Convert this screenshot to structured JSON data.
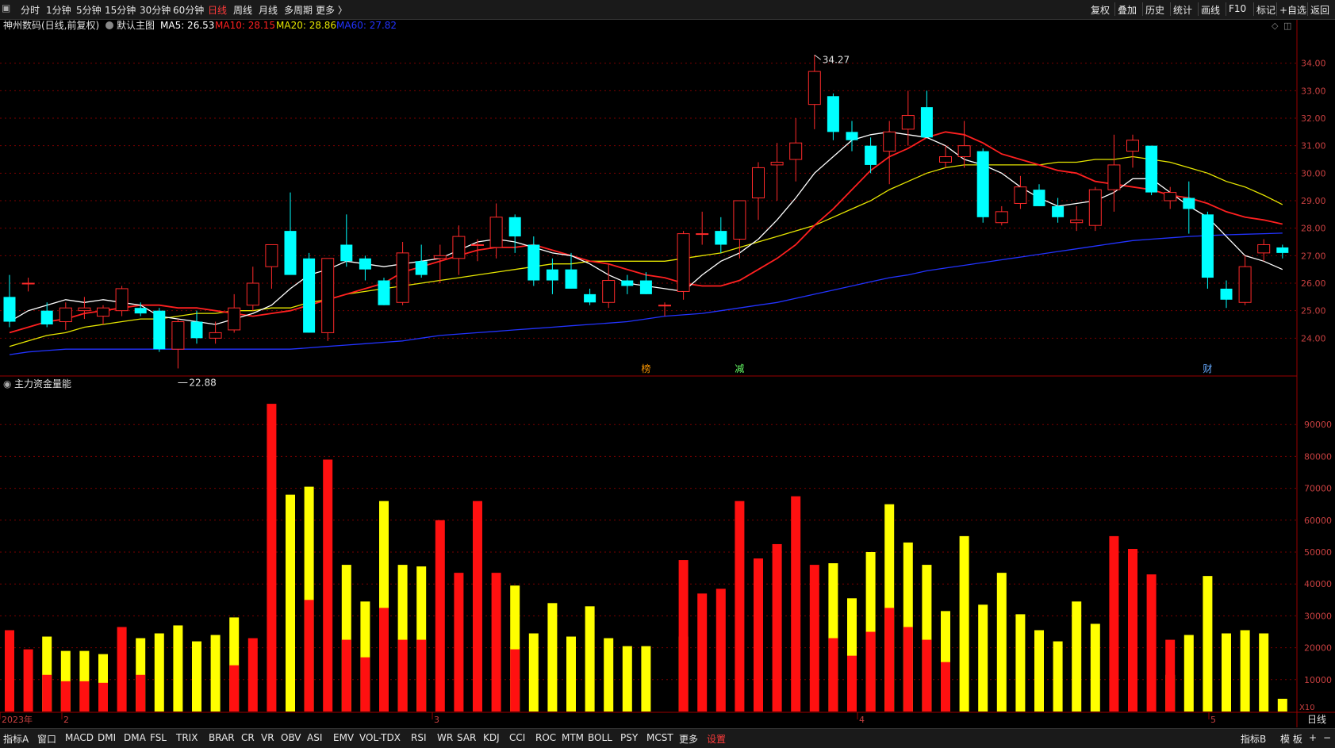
{
  "toolbar": {
    "left": [
      {
        "id": "minute",
        "label": "分时"
      },
      {
        "id": "1m",
        "label": "1分钟"
      },
      {
        "id": "5m",
        "label": "5分钟"
      },
      {
        "id": "15m",
        "label": "15分钟"
      },
      {
        "id": "30m",
        "label": "30分钟"
      },
      {
        "id": "60m",
        "label": "60分钟"
      },
      {
        "id": "day",
        "label": "日线",
        "active": true
      },
      {
        "id": "week",
        "label": "周线"
      },
      {
        "id": "month",
        "label": "月线"
      },
      {
        "id": "multi",
        "label": "多周期"
      },
      {
        "id": "more",
        "label": "更多 〉"
      }
    ],
    "right": [
      {
        "id": "fuquan",
        "label": "复权"
      },
      {
        "id": "diejia",
        "label": "叠加"
      },
      {
        "id": "lishi",
        "label": "历史"
      },
      {
        "id": "tongji",
        "label": "统计"
      },
      {
        "id": "huaxian",
        "label": "画线"
      },
      {
        "id": "f10",
        "label": "F10"
      },
      {
        "id": "biaoji",
        "label": "标记"
      },
      {
        "id": "zixuan",
        "label": "+自选"
      },
      {
        "id": "fanhui",
        "label": "返回"
      }
    ]
  },
  "legend": {
    "stock": "神州数码(日线,前复权)",
    "main_template": "默认主图",
    "ma5": "MA5: 26.53",
    "ma10": "MA10: 28.15",
    "ma20": "MA20: 28.86",
    "ma60": "MA60: 27.82",
    "indicator_title": "主力资金量能"
  },
  "colors": {
    "up": "#ff2a2a",
    "down": "#00ffff",
    "ma5": "#ffffff",
    "ma10": "#ff2020",
    "ma20": "#e6e600",
    "ma60": "#2233ff",
    "vol_red": "#ff1010",
    "vol_yellow": "#ffff00",
    "grid": "#7a0000",
    "axis_text": "#c84040"
  },
  "chart_data": [
    {
      "type": "candlestick",
      "title": "神州数码(日线,前复权)",
      "ylim": [
        23.0,
        35.0
      ],
      "y_ticks": [
        24.0,
        25.0,
        26.0,
        27.0,
        28.0,
        29.0,
        30.0,
        31.0,
        32.0,
        33.0,
        34.0
      ],
      "max_label": "34.27",
      "min_label": "22.88",
      "markers": [
        "榜",
        "减",
        "财"
      ],
      "x_labels": [
        "2023年",
        "2",
        "3",
        "4",
        "5"
      ],
      "ohlc": [
        [
          25.5,
          26.3,
          24.4,
          24.6
        ],
        [
          26.0,
          26.2,
          25.7,
          26.0
        ],
        [
          25.0,
          25.3,
          24.4,
          24.5
        ],
        [
          24.6,
          25.3,
          24.3,
          25.1
        ],
        [
          25.0,
          25.5,
          24.7,
          25.1
        ],
        [
          24.8,
          25.2,
          24.5,
          25.1
        ],
        [
          25.0,
          25.9,
          24.8,
          25.8
        ],
        [
          25.1,
          25.3,
          24.8,
          24.9
        ],
        [
          25.0,
          25.1,
          23.5,
          23.6
        ],
        [
          23.6,
          24.7,
          22.9,
          24.6
        ],
        [
          24.6,
          25.0,
          23.8,
          24.0
        ],
        [
          24.0,
          24.6,
          23.8,
          24.2
        ],
        [
          24.3,
          25.6,
          24.2,
          25.1
        ],
        [
          25.2,
          26.6,
          25.0,
          26.0
        ],
        [
          26.6,
          27.3,
          25.8,
          27.4
        ],
        [
          27.9,
          29.3,
          26.7,
          26.3
        ],
        [
          26.9,
          27.1,
          24.2,
          24.2
        ],
        [
          24.2,
          26.9,
          23.9,
          26.9
        ],
        [
          27.4,
          28.5,
          26.6,
          26.8
        ],
        [
          26.9,
          27.0,
          26.1,
          26.5
        ],
        [
          26.1,
          26.2,
          25.2,
          25.2
        ],
        [
          25.3,
          27.5,
          25.2,
          27.1
        ],
        [
          26.8,
          27.4,
          26.2,
          26.3
        ],
        [
          26.9,
          27.4,
          26.0,
          27.0
        ],
        [
          26.9,
          28.1,
          26.3,
          27.7
        ],
        [
          27.4,
          27.6,
          26.8,
          27.4
        ],
        [
          27.3,
          28.9,
          26.9,
          28.4
        ],
        [
          28.4,
          28.5,
          27.1,
          27.7
        ],
        [
          27.4,
          27.7,
          25.9,
          26.1
        ],
        [
          26.5,
          26.9,
          25.6,
          26.1
        ],
        [
          26.5,
          27.1,
          25.8,
          25.8
        ],
        [
          25.6,
          25.8,
          25.2,
          25.3
        ],
        [
          25.3,
          26.7,
          25.1,
          26.1
        ],
        [
          26.1,
          26.3,
          25.6,
          25.9
        ],
        [
          26.1,
          26.4,
          25.6,
          25.6
        ],
        [
          25.2,
          25.3,
          24.8,
          25.2
        ],
        [
          25.7,
          27.9,
          25.4,
          27.8
        ],
        [
          27.8,
          28.6,
          27.4,
          27.8
        ],
        [
          27.9,
          28.4,
          27.1,
          27.4
        ],
        [
          27.6,
          29.0,
          26.9,
          29.0
        ],
        [
          29.1,
          30.4,
          28.3,
          30.2
        ],
        [
          30.3,
          31.1,
          29.0,
          30.4
        ],
        [
          30.5,
          32.0,
          29.7,
          31.1
        ],
        [
          32.5,
          34.3,
          31.6,
          33.7
        ],
        [
          32.8,
          32.9,
          31.2,
          31.5
        ],
        [
          31.5,
          31.9,
          30.8,
          31.2
        ],
        [
          31.0,
          31.3,
          30.0,
          30.3
        ],
        [
          30.8,
          31.9,
          29.6,
          31.5
        ],
        [
          31.6,
          33.0,
          31.0,
          32.1
        ],
        [
          32.4,
          33.0,
          31.3,
          31.3
        ],
        [
          30.4,
          31.0,
          30.2,
          30.6
        ],
        [
          30.6,
          31.9,
          30.2,
          31.0
        ],
        [
          30.8,
          30.9,
          28.2,
          28.4
        ],
        [
          28.2,
          28.8,
          28.1,
          28.6
        ],
        [
          28.9,
          29.9,
          28.7,
          29.5
        ],
        [
          29.4,
          29.6,
          28.8,
          28.8
        ],
        [
          28.8,
          29.1,
          28.2,
          28.4
        ],
        [
          28.2,
          28.8,
          27.9,
          28.3
        ],
        [
          28.1,
          29.5,
          27.9,
          29.4
        ],
        [
          29.4,
          31.4,
          28.6,
          30.3
        ],
        [
          30.8,
          31.4,
          30.2,
          31.2
        ],
        [
          31.0,
          31.0,
          29.2,
          29.3
        ],
        [
          29.0,
          29.5,
          28.7,
          29.3
        ],
        [
          29.1,
          29.7,
          27.8,
          28.7
        ],
        [
          28.5,
          28.6,
          25.8,
          26.2
        ],
        [
          25.8,
          26.1,
          25.1,
          25.4
        ],
        [
          25.3,
          27.0,
          25.2,
          26.6
        ],
        [
          27.1,
          27.6,
          26.8,
          27.4
        ],
        [
          27.3,
          27.4,
          26.9,
          27.1
        ]
      ],
      "ma5": [
        24.6,
        25.0,
        25.2,
        25.4,
        25.3,
        25.4,
        25.3,
        25.2,
        24.8,
        24.7,
        24.6,
        24.5,
        24.7,
        24.9,
        25.2,
        25.8,
        26.3,
        26.5,
        26.8,
        26.7,
        26.6,
        26.7,
        26.8,
        26.9,
        27.2,
        27.5,
        27.6,
        27.5,
        27.3,
        27.1,
        27.0,
        26.7,
        26.3,
        26.0,
        25.9,
        25.8,
        25.7,
        26.3,
        26.8,
        27.1,
        27.6,
        28.3,
        29.1,
        30.0,
        30.6,
        31.2,
        31.4,
        31.5,
        31.4,
        31.3,
        31.0,
        30.5,
        30.3,
        30.0,
        29.5,
        29.1,
        28.8,
        28.9,
        29.0,
        29.3,
        29.8,
        29.8,
        29.3,
        28.8,
        28.4,
        27.7,
        27.0,
        26.8,
        26.5
      ],
      "ma10": [
        24.2,
        24.4,
        24.6,
        24.7,
        24.9,
        25.0,
        25.1,
        25.2,
        25.2,
        25.1,
        25.1,
        25.0,
        24.9,
        24.8,
        24.9,
        25.0,
        25.2,
        25.4,
        25.6,
        25.8,
        26.0,
        26.4,
        26.6,
        26.8,
        27.0,
        27.2,
        27.3,
        27.3,
        27.4,
        27.2,
        27.0,
        26.8,
        26.7,
        26.5,
        26.3,
        26.2,
        26.0,
        25.9,
        25.9,
        26.1,
        26.5,
        26.9,
        27.4,
        28.1,
        28.7,
        29.4,
        30.1,
        30.6,
        30.9,
        31.3,
        31.5,
        31.4,
        31.1,
        30.7,
        30.5,
        30.3,
        30.1,
        30.0,
        29.7,
        29.6,
        29.5,
        29.4,
        29.2,
        29.1,
        28.9,
        28.6,
        28.4,
        28.3,
        28.15
      ],
      "ma20": [
        23.7,
        23.9,
        24.1,
        24.2,
        24.4,
        24.5,
        24.6,
        24.7,
        24.7,
        24.8,
        24.9,
        24.9,
        25.0,
        25.0,
        25.1,
        25.1,
        25.3,
        25.4,
        25.6,
        25.7,
        25.8,
        25.9,
        26.0,
        26.1,
        26.2,
        26.3,
        26.4,
        26.5,
        26.6,
        26.7,
        26.7,
        26.8,
        26.8,
        26.8,
        26.8,
        26.8,
        26.9,
        27.0,
        27.1,
        27.3,
        27.5,
        27.7,
        27.9,
        28.1,
        28.4,
        28.7,
        29.0,
        29.4,
        29.7,
        30.0,
        30.2,
        30.3,
        30.3,
        30.3,
        30.3,
        30.3,
        30.4,
        30.4,
        30.5,
        30.5,
        30.6,
        30.5,
        30.4,
        30.2,
        30.0,
        29.7,
        29.5,
        29.2,
        28.86
      ],
      "ma60": [
        23.4,
        23.5,
        23.55,
        23.6,
        23.6,
        23.6,
        23.6,
        23.6,
        23.6,
        23.6,
        23.6,
        23.6,
        23.6,
        23.6,
        23.6,
        23.6,
        23.65,
        23.7,
        23.75,
        23.8,
        23.85,
        23.9,
        24.0,
        24.1,
        24.15,
        24.2,
        24.25,
        24.3,
        24.35,
        24.4,
        24.45,
        24.5,
        24.55,
        24.6,
        24.7,
        24.8,
        24.85,
        24.9,
        25.0,
        25.1,
        25.2,
        25.3,
        25.45,
        25.6,
        25.75,
        25.9,
        26.05,
        26.2,
        26.3,
        26.45,
        26.55,
        26.65,
        26.75,
        26.85,
        26.95,
        27.05,
        27.15,
        27.25,
        27.35,
        27.45,
        27.55,
        27.6,
        27.65,
        27.7,
        27.73,
        27.76,
        27.78,
        27.8,
        27.82
      ]
    },
    {
      "type": "bar",
      "title": "主力资金量能",
      "ylim": [
        0,
        100000
      ],
      "y_ticks": [
        10000,
        20000,
        30000,
        40000,
        50000,
        60000,
        70000,
        80000,
        90000
      ],
      "unit_label": "X10",
      "series": [
        {
          "name": "红",
          "values": [
            25500,
            19500,
            11500,
            9500,
            9500,
            9000,
            26500,
            11500,
            0,
            0,
            0,
            0,
            14500,
            23000,
            96500,
            0,
            35000,
            79000,
            22500,
            17000,
            32500,
            22500,
            22500,
            60000,
            43500,
            66000,
            43500,
            19500,
            0,
            0,
            0,
            0,
            0,
            0,
            0,
            0,
            47500,
            37000,
            38500,
            66000,
            48000,
            52500,
            67500,
            46000,
            23000,
            17500,
            25000,
            32500,
            26500,
            22500,
            15500,
            0,
            0,
            0,
            0,
            0,
            0,
            0,
            0,
            55000,
            51000,
            43000,
            22500,
            0,
            0,
            0,
            0,
            0,
            0
          ]
        },
        {
          "name": "黄",
          "values": [
            0,
            0,
            23500,
            19000,
            19000,
            18000,
            0,
            23000,
            24500,
            27000,
            22000,
            24000,
            29500,
            0,
            0,
            68000,
            70500,
            0,
            46000,
            34500,
            66000,
            46000,
            45500,
            0,
            0,
            0,
            0,
            39500,
            24500,
            34000,
            23500,
            33000,
            23000,
            20500,
            20500,
            0,
            23500,
            0,
            0,
            0,
            0,
            0,
            0,
            0,
            46500,
            35500,
            50000,
            65000,
            53000,
            46000,
            31500,
            55000,
            33500,
            43500,
            30500,
            25500,
            22000,
            34500,
            27500,
            0,
            0,
            0,
            11500,
            24000,
            42500,
            24500,
            25500,
            24500,
            4000
          ]
        }
      ]
    }
  ],
  "bottombar": {
    "left": [
      "指标A",
      "窗口",
      "MACD",
      "DMI",
      "DMA",
      "FSL",
      "TRIX",
      "BRAR",
      "CR",
      "VR",
      "OBV",
      "ASI",
      "EMV",
      "VOL-TDX",
      "RSI",
      "WR",
      "SAR",
      "KDJ",
      "CCI",
      "ROC",
      "MTM",
      "BOLL",
      "PSY",
      "MCST",
      "更多",
      "设置"
    ],
    "right": [
      "指标B",
      "模 板",
      "+",
      "−"
    ],
    "period_label": "日线"
  }
}
